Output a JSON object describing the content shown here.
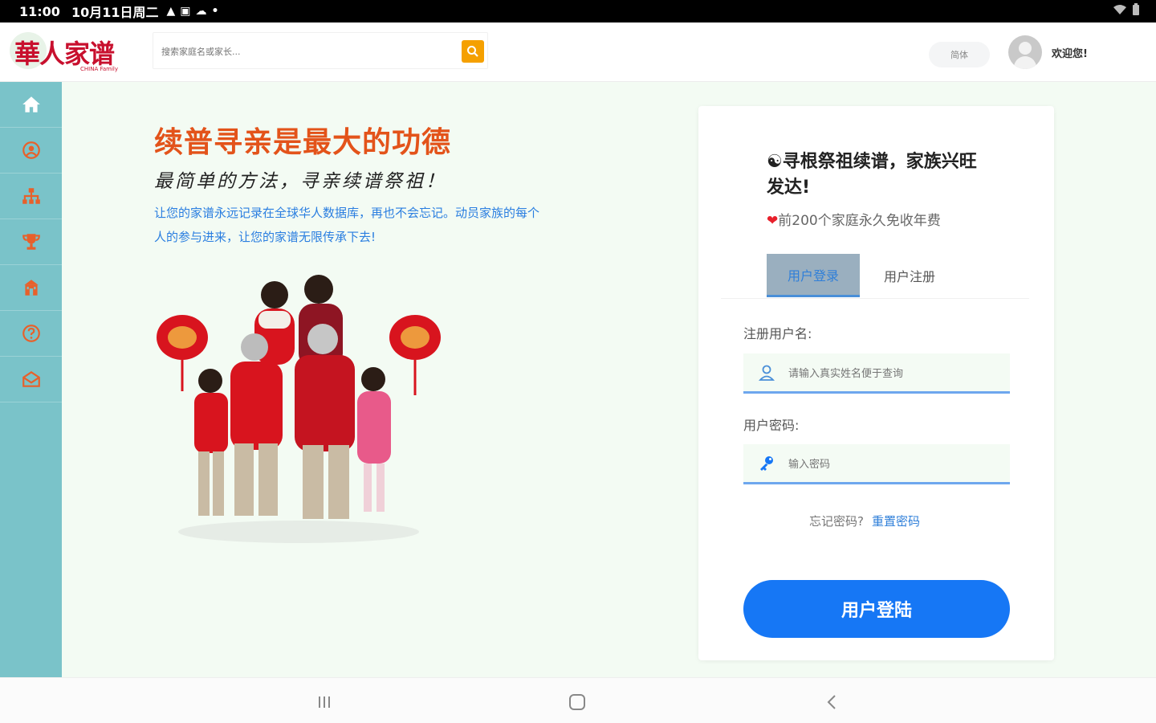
{
  "status_bar": {
    "time": "11:00",
    "date": "10月11日周二"
  },
  "header": {
    "logo_text": "華人家谱",
    "logo_sub": "CHINA Family",
    "search_placeholder": "搜索家庭名或家长...",
    "lang_button": "简体",
    "welcome_text": "欢迎您!"
  },
  "sidebar": {
    "items": [
      {
        "icon": "home-icon"
      },
      {
        "icon": "user-circle-icon"
      },
      {
        "icon": "family-tree-icon"
      },
      {
        "icon": "trophy-icon"
      },
      {
        "icon": "temple-icon"
      },
      {
        "icon": "help-icon"
      },
      {
        "icon": "mail-icon"
      }
    ]
  },
  "main": {
    "title": "续普寻亲是最大的功德",
    "subtitle": "最简单的方法，寻亲续谱祭祖！",
    "description": "让您的家谱永远记录在全球华人数据库，再也不会忘记。动员家族的每个人的参与进来，让您的家谱无限传承下去!"
  },
  "login_card": {
    "title": "☯寻根祭祖续谱，家族兴旺发达!",
    "promo_heart": "❤",
    "promo_text": "前200个家庭永久免收年费",
    "tab_login": "用户登录",
    "tab_register": "用户注册",
    "username_label": "注册用户名:",
    "username_placeholder": "请输入真实姓名便于查询",
    "password_label": "用户密码:",
    "password_placeholder": "输入密码",
    "forgot_text": "忘记密码?",
    "reset_link": "重置密码",
    "login_button": "用户登陆"
  },
  "colors": {
    "sidebar": "#7ac3c9",
    "accent_orange": "#e3531a",
    "link_blue": "#2f7fd9",
    "button_blue": "#1677f5",
    "background_green": "#f3fbf3"
  }
}
